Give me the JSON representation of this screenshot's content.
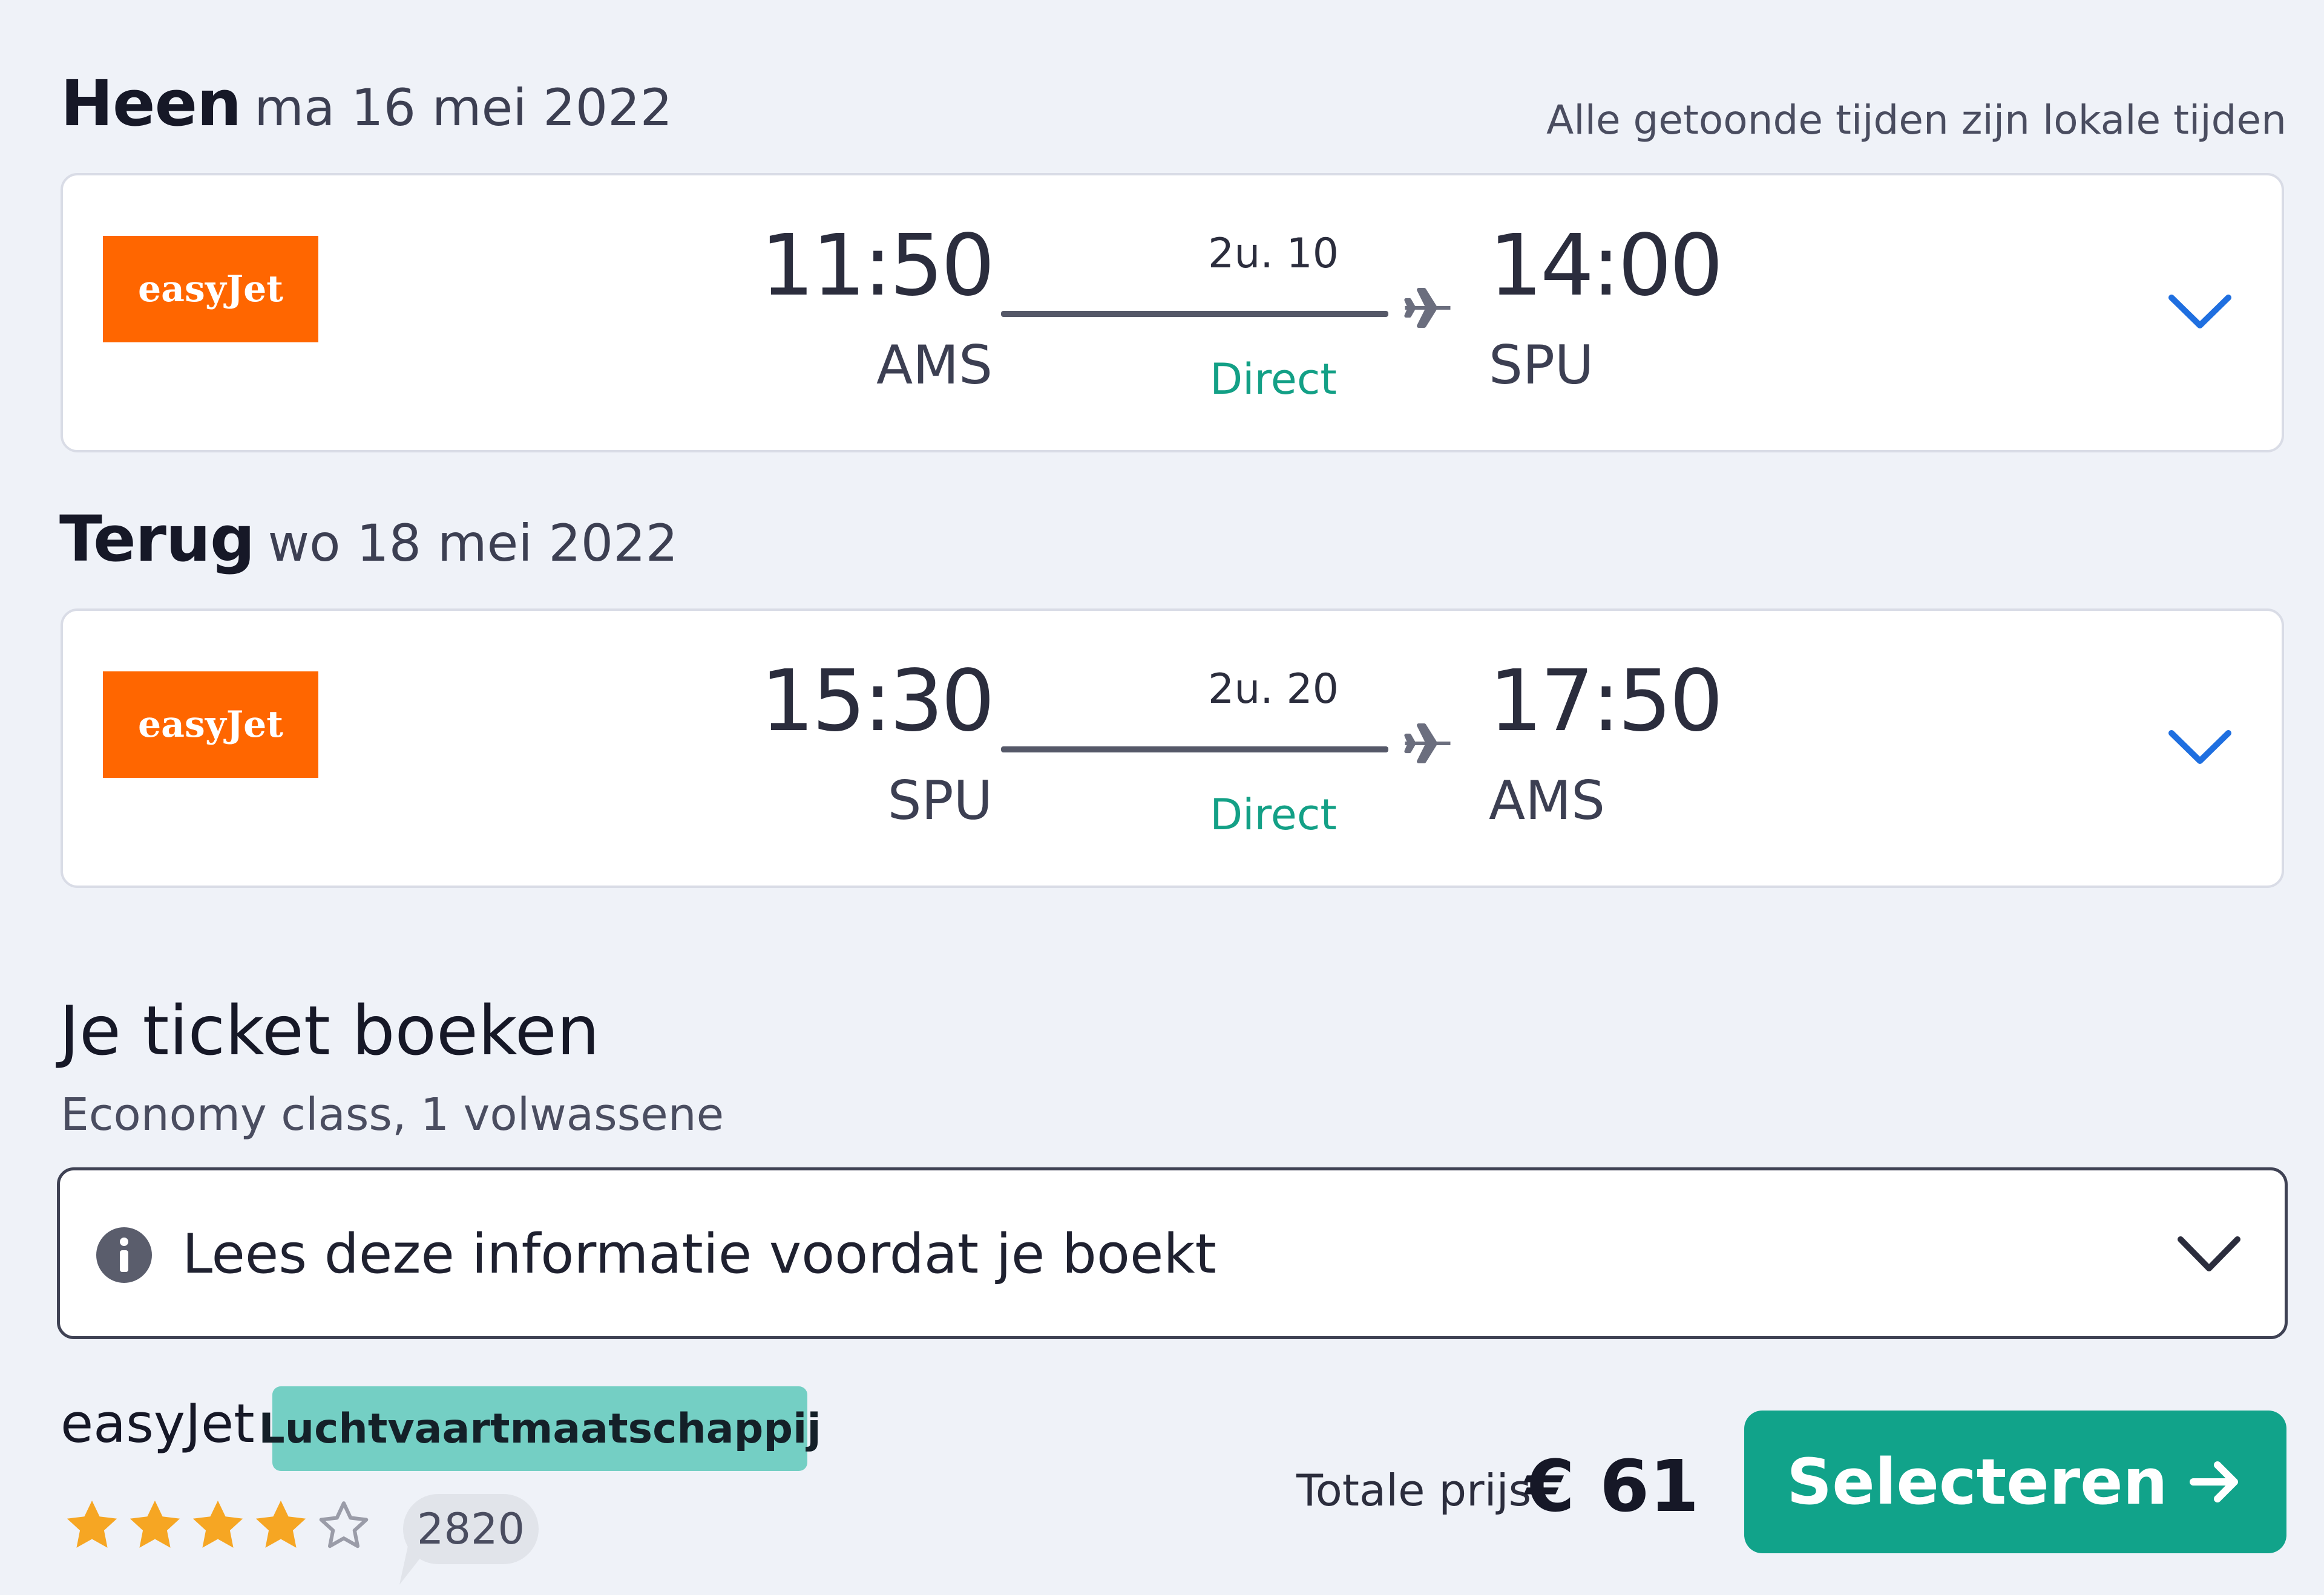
{
  "timezone_note": "Alle getoonde tijden zijn lokale tijden",
  "outbound": {
    "title": "Heen",
    "date": "ma 16 mei 2022",
    "airline_logo_text": "easyJet",
    "dep_time": "11:50",
    "dep_code": "AMS",
    "duration": "2u. 10",
    "stops": "Direct",
    "arr_time": "14:00",
    "arr_code": "SPU"
  },
  "return": {
    "title": "Terug",
    "date": "wo 18 mei 2022",
    "airline_logo_text": "easyJet",
    "dep_time": "15:30",
    "dep_code": "SPU",
    "duration": "2u. 20",
    "stops": "Direct",
    "arr_time": "17:50",
    "arr_code": "AMS"
  },
  "booking": {
    "title": "Je ticket boeken",
    "subtitle": "Economy class, 1 volwassene",
    "info_text": "Lees deze informatie voordat je boekt",
    "airline_name": "easyJet",
    "airline_badge": "Luchtvaartmaatschappij",
    "rating_stars": 4,
    "rating_max": 5,
    "review_count": "2820",
    "total_label": "Totale prijs",
    "total_price": "€ 61",
    "select_label": "Selecteren"
  },
  "colors": {
    "logo": "#ff6600",
    "direct": "#13a086",
    "chevron": "#1f6fe0",
    "button": "#11a38a",
    "badge": "#74cfc4",
    "star": "#f6a623"
  },
  "icons": {
    "plane": "plane-icon",
    "expand": "chevron-down-icon",
    "info": "info-icon",
    "star": "star-icon",
    "arrow": "arrow-right-icon"
  }
}
